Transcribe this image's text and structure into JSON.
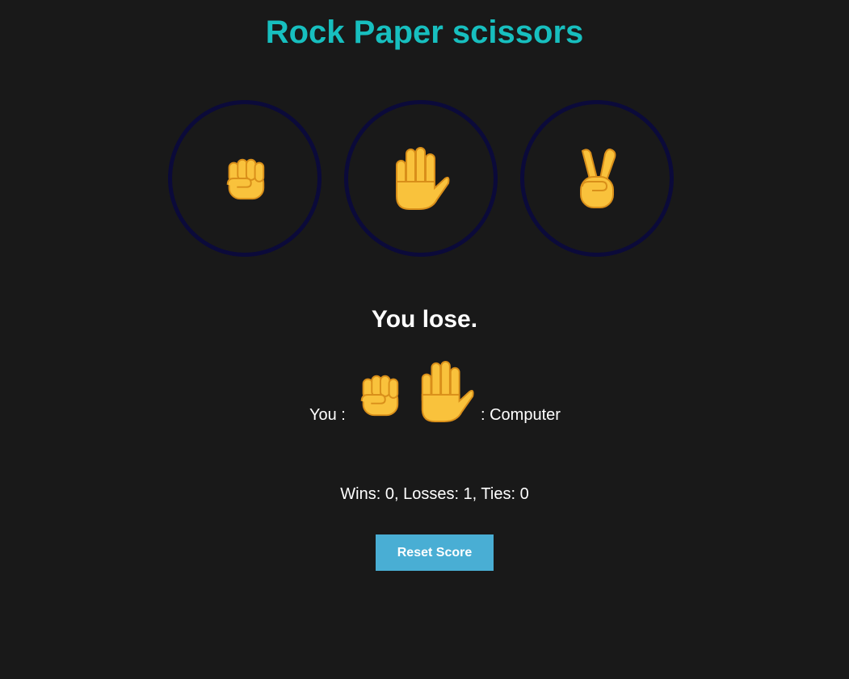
{
  "title": "Rock Paper scissors",
  "colors": {
    "background": "#191919",
    "title": "#17bfbf",
    "circle_border": "#0b0a3a",
    "hand": "#f9c23c",
    "hand_line": "#d98f1a",
    "button": "#49aed4"
  },
  "choices": [
    {
      "name": "rock",
      "icon": "raised-fist-icon"
    },
    {
      "name": "paper",
      "icon": "raised-hand-icon"
    },
    {
      "name": "scissors",
      "icon": "victory-hand-icon"
    }
  ],
  "result": "You lose.",
  "moves": {
    "you_label": "You :",
    "computer_label": ": Computer",
    "you_icon": "raised-fist-icon",
    "computer_icon": "raised-hand-icon"
  },
  "score": {
    "text": "Wins: 0, Losses: 1, Ties: 0",
    "wins": 0,
    "losses": 1,
    "ties": 0
  },
  "reset_button": "Reset Score"
}
